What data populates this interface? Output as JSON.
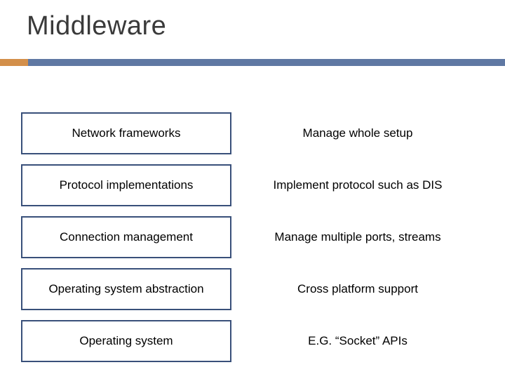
{
  "title": "Middleware",
  "rows": [
    {
      "label": "Network frameworks",
      "desc": "Manage whole setup"
    },
    {
      "label": "Protocol implementations",
      "desc": "Implement protocol such as DIS"
    },
    {
      "label": "Connection management",
      "desc": "Manage multiple ports, streams"
    },
    {
      "label": "Operating system abstraction",
      "desc": "Cross platform support"
    },
    {
      "label": "Operating system",
      "desc": "E.G. “Socket” APIs"
    }
  ]
}
